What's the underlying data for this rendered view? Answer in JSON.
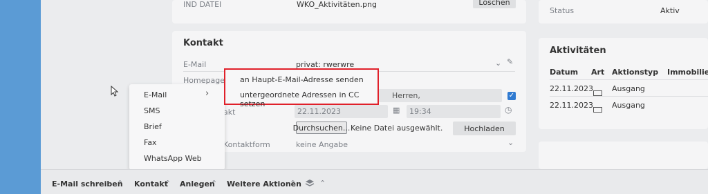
{
  "top_row": {
    "label": "IND DATEI",
    "filename": "WKO_Aktivitäten.png",
    "delete_button": "Löschen"
  },
  "status_card": {
    "label": "Status",
    "value": "Aktiv"
  },
  "kontakt": {
    "title": "Kontakt",
    "email_label": "E-Mail",
    "email_value": "privat: rwerwre",
    "homepage_label": "Homepage",
    "anrede_value": "Herren,",
    "date_label_fragment": "akt",
    "date_value": "22.11.2023",
    "time_value": "19:34",
    "browse_button": "Durchsuchen...",
    "no_file_text": "Keine Datei ausgewählt.",
    "upload_button": "Hochladen",
    "kontaktform_label": "Kontaktform",
    "kontaktform_value": "keine Angabe"
  },
  "aktivitaeten": {
    "title": "Aktivitäten",
    "columns": [
      "Datum",
      "Art",
      "Aktionstyp",
      "Immobilie"
    ],
    "rows": [
      {
        "datum": "22.11.2023",
        "art": "email",
        "aktionstyp": "Ausgang",
        "immobilie": ""
      },
      {
        "datum": "22.11.2023",
        "art": "email",
        "aktionstyp": "Ausgang",
        "immobilie": ""
      }
    ]
  },
  "context_menu": {
    "items": [
      "E-Mail",
      "SMS",
      "Brief",
      "Fax",
      "WhatsApp Web"
    ],
    "submenu_arrow": "›"
  },
  "submenu": {
    "items": [
      "an Haupt-E-Mail-Adresse senden",
      "untergeordnete Adressen in CC setzen"
    ]
  },
  "bottom_bar": {
    "items": [
      "E-Mail schreiben",
      "Kontakt",
      "Anlegen",
      "Weitere Aktionen"
    ]
  },
  "colors": {
    "accent": "#5b9bd5",
    "checkbox": "#2f7ad1",
    "highlight": "#e0202a"
  }
}
